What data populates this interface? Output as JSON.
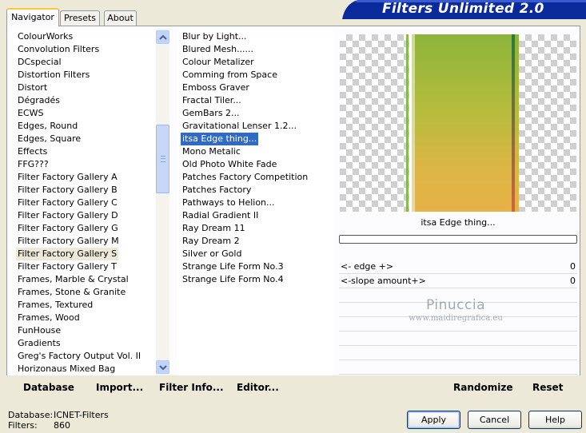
{
  "tabs": [
    {
      "label": "Navigator",
      "active": true
    },
    {
      "label": "Presets",
      "active": false
    },
    {
      "label": "About",
      "active": false
    }
  ],
  "banner_title": "Filters Unlimited 2.0",
  "categories": [
    "ColourWorks",
    "Convolution Filters",
    "DCspecial",
    "Distortion Filters",
    "Distort",
    "Dégradés",
    "ECWS",
    "Edges, Round",
    "Edges, Square",
    "Effects",
    "FFG???",
    "Filter Factory Gallery A",
    "Filter Factory Gallery B",
    "Filter Factory Gallery C",
    "Filter Factory Gallery D",
    "Filter Factory Gallery G",
    "Filter Factory Gallery M",
    "Filter Factory Gallery S",
    "Filter Factory Gallery T",
    "Frames, Marble & Crystal",
    "Frames, Stone & Granite",
    "Frames, Textured",
    "Frames, Wood",
    "FunHouse",
    "Gradients",
    "Greg's Factory Output Vol. II",
    "Horizonaus Mixed Bag"
  ],
  "selected_category_index": 17,
  "filters": [
    "Blur by Light...",
    "Blured Mesh......",
    "Colour Metalizer",
    "Comming from Space",
    "Emboss Graver",
    "Fractal Tiler...",
    "GemBars 2...",
    "Gravitational Lenser 1.2...",
    "itsa Edge thing...",
    "Mono Metalic",
    "Old Photo White Fade",
    "Patches Factory Competition",
    "Patches Factory",
    "Pathways to Helion...",
    "Radial Gradient II",
    "Ray Dream 11",
    "Ray Dream 2",
    "Silver or Gold",
    "Strange Life Form No.3",
    "Strange Life Form No.4"
  ],
  "selected_filter_index": 8,
  "current_filter_name": "itsa Edge thing...",
  "parameters": [
    {
      "label": "<- edge +>",
      "value": "0"
    },
    {
      "label": "<-slope amount+>",
      "value": "0"
    },
    {
      "label": "",
      "value": ""
    },
    {
      "label": "",
      "value": ""
    },
    {
      "label": "",
      "value": ""
    },
    {
      "label": "",
      "value": ""
    },
    {
      "label": "",
      "value": ""
    },
    {
      "label": "",
      "value": ""
    }
  ],
  "watermark": {
    "line1": "Pinuccia",
    "line2": "www.maidiregrafica.eu"
  },
  "bottom_buttons": {
    "database": "Database",
    "import": "Import...",
    "filter_info": "Filter Info...",
    "editor": "Editor...",
    "randomize": "Randomize",
    "reset": "Reset"
  },
  "status": {
    "database_label": "Database:",
    "database_value": "ICNET-Filters",
    "filters_label": "Filters:",
    "filters_value": "860"
  },
  "dialog_buttons": {
    "apply": "Apply",
    "cancel": "Cancel",
    "help": "Help"
  },
  "colors": {
    "banner_blue": "#0a2a9c",
    "selection_blue": "#316ac5",
    "gradient_top": "#8cb43a",
    "gradient_bottom": "#e7b247"
  }
}
